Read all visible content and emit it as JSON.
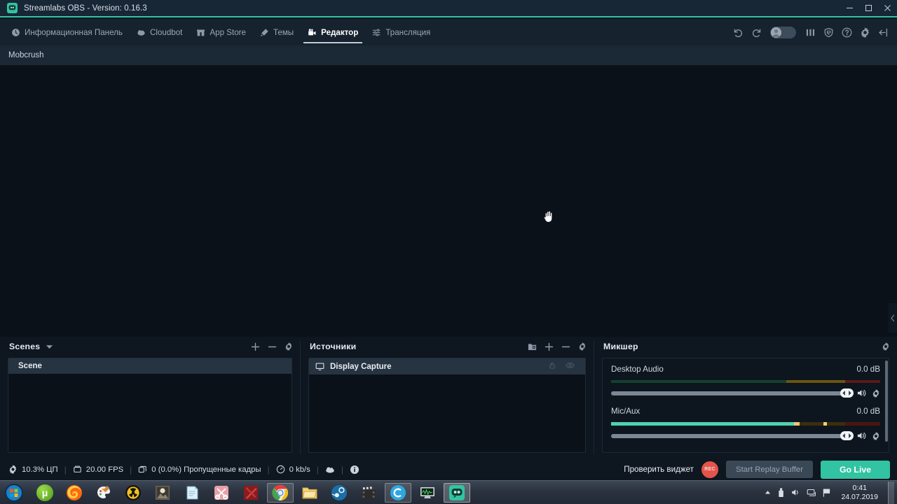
{
  "titlebar": {
    "app_name": "Streamlabs OBS - Version: 0.16.3",
    "logo_icon": "streamlabs-logo-icon",
    "minimize_label": "minimize-icon",
    "maximize_label": "maximize-icon",
    "close_label": "close-icon",
    "accent_color": "#31c3a2"
  },
  "nav": {
    "items": [
      {
        "label": "Информационная Панель",
        "icon": "dashboard-icon",
        "active": false
      },
      {
        "label": "Cloudbot",
        "icon": "cloud-icon",
        "active": false
      },
      {
        "label": "App Store",
        "icon": "store-icon",
        "active": false
      },
      {
        "label": "Темы",
        "icon": "themes-icon",
        "active": false
      },
      {
        "label": "Редактор",
        "icon": "editor-camera-icon",
        "active": true
      },
      {
        "label": "Трансляция",
        "icon": "stream-sliders-icon",
        "active": false
      }
    ],
    "right_controls": [
      {
        "name": "undo-icon"
      },
      {
        "name": "redo-icon"
      },
      {
        "name": "profile-toggle"
      },
      {
        "name": "mixer-panel-icon"
      },
      {
        "name": "shield-icon"
      },
      {
        "name": "help-icon"
      },
      {
        "name": "settings-gear-icon"
      },
      {
        "name": "collapse-sidebar-icon"
      }
    ]
  },
  "subtab": {
    "label": "Mobcrush"
  },
  "preview": {
    "cursor": "open-hand-cursor",
    "edge_collapse_icon": "chevron-left-icon"
  },
  "scenes": {
    "title": "Scenes",
    "caret_icon": "chevron-down-icon",
    "actions": [
      "add-scene-icon",
      "remove-scene-icon",
      "scene-settings-gear-icon"
    ],
    "items": [
      {
        "label": "Scene",
        "selected": true
      }
    ]
  },
  "sources": {
    "title": "Источники",
    "actions": [
      "add-folder-icon",
      "add-source-icon",
      "remove-source-icon",
      "source-settings-gear-icon"
    ],
    "items": [
      {
        "label": "Display Capture",
        "icon": "monitor-icon",
        "lock_icon": "lock-icon",
        "visibility_icon": "eye-icon"
      }
    ]
  },
  "mixer": {
    "title": "Микшер",
    "settings_icon": "mixer-settings-gear-icon",
    "channels": [
      {
        "name": "Desktop Audio",
        "db": "0.0 dB",
        "level_percent": 0,
        "meter_style": "idle",
        "volume_percent": 100,
        "mute_icon": "speaker-icon",
        "gear_icon": "channel-settings-gear-icon"
      },
      {
        "name": "Mic/Aux",
        "db": "0.0 dB",
        "level_percent": 68,
        "meter_style": "active",
        "volume_percent": 100,
        "mute_icon": "speaker-icon",
        "gear_icon": "channel-settings-gear-icon"
      }
    ]
  },
  "status": {
    "cpu": "10.3% ЦП",
    "cpu_icon": "cpu-gear-icon",
    "fps": "20.00 FPS",
    "fps_icon": "fps-icon",
    "dropped": "0 (0.0%) Пропущенные кадры",
    "dropped_icon": "frames-icon",
    "bitrate": "0 kb/s",
    "bitrate_icon": "bitrate-icon",
    "cloud_icon": "cloud-status-icon",
    "info_icon": "info-icon",
    "check_widget_label": "Проверить виджет",
    "record_label": "REC",
    "replay_buffer_label": "Start Replay Buffer",
    "go_live_label": "Go Live",
    "go_live_color": "#31c3a2",
    "rec_color": "#e4544a"
  },
  "taskbar": {
    "start_icon": "windows-start-orb",
    "items": [
      {
        "name": "utorrent-icon",
        "state": "pinned"
      },
      {
        "name": "firefox-icon",
        "state": "pinned"
      },
      {
        "name": "paint-icon",
        "state": "pinned"
      },
      {
        "name": "radiation-app-icon",
        "state": "pinned"
      },
      {
        "name": "photo-viewer-icon",
        "state": "pinned"
      },
      {
        "name": "notepad-icon",
        "state": "pinned"
      },
      {
        "name": "scissors-snip-icon",
        "state": "pinned"
      },
      {
        "name": "dota2-icon",
        "state": "pinned"
      },
      {
        "name": "chrome-icon",
        "state": "open"
      },
      {
        "name": "file-explorer-icon",
        "state": "pinned"
      },
      {
        "name": "steam-icon",
        "state": "pinned"
      },
      {
        "name": "movie-maker-icon",
        "state": "pinned"
      },
      {
        "name": "ccleaner-icon",
        "state": "open"
      },
      {
        "name": "system-monitor-icon",
        "state": "pinned"
      },
      {
        "name": "streamlabs-obs-icon",
        "state": "active"
      }
    ],
    "tray": [
      {
        "name": "tray-expand-icon"
      },
      {
        "name": "tray-usb-icon"
      },
      {
        "name": "tray-volume-icon"
      },
      {
        "name": "tray-network-icon"
      },
      {
        "name": "tray-flag-icon"
      }
    ],
    "clock_time": "0:41",
    "clock_date": "24.07.2019"
  }
}
